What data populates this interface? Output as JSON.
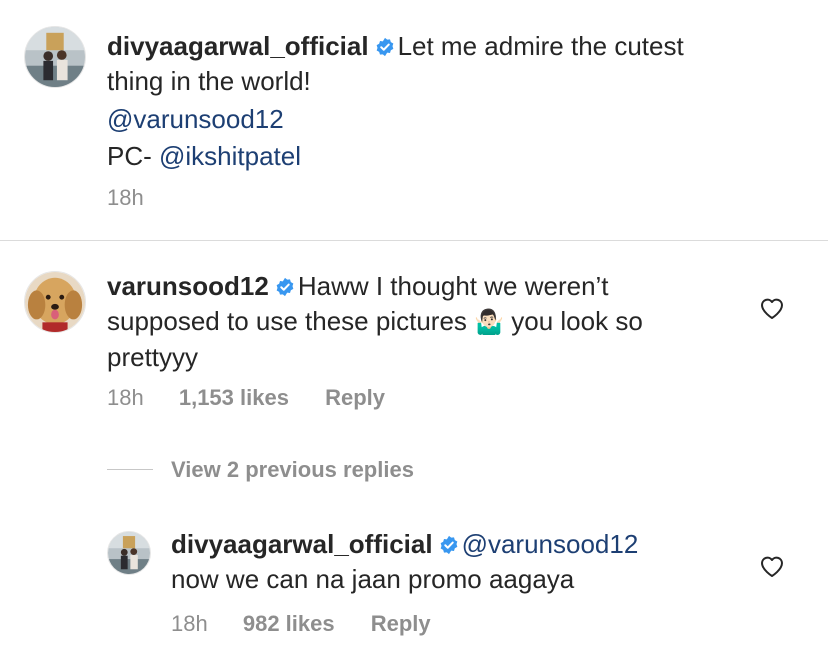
{
  "caption": {
    "username": "divyaagarwal_official",
    "text_line1": "Let me admire the cutest",
    "text_line2": "thing in the world!",
    "mention_line": "@varunsood12",
    "pc_prefix": "PC- ",
    "pc_mention": "@ikshitpatel",
    "time": "18h"
  },
  "comment": {
    "username": "varunsood12",
    "text_line1": "Haww I thought we weren’t",
    "text_line2_a": "supposed to use these pictures",
    "emoji": "🤷🏻‍♂️",
    "text_line2_b": "you look so",
    "text_line3": "prettyyy",
    "time": "18h",
    "likes": "1,153 likes",
    "reply_label": "Reply"
  },
  "view_replies_label": "View 2 previous replies",
  "reply": {
    "username": "divyaagarwal_official",
    "mention": "@varunsood12",
    "text_line2": "now we can na jaan promo aagaya",
    "time": "18h",
    "likes": "982 likes",
    "reply_label": "Reply"
  },
  "colors": {
    "verified_blue": "#3897f0",
    "mention_blue": "#1d3f73",
    "meta_gray": "#8e8e8e",
    "divider": "#dbdbdb"
  },
  "icons": {
    "verified": "verified-badge-icon",
    "like": "heart-outline-icon"
  }
}
